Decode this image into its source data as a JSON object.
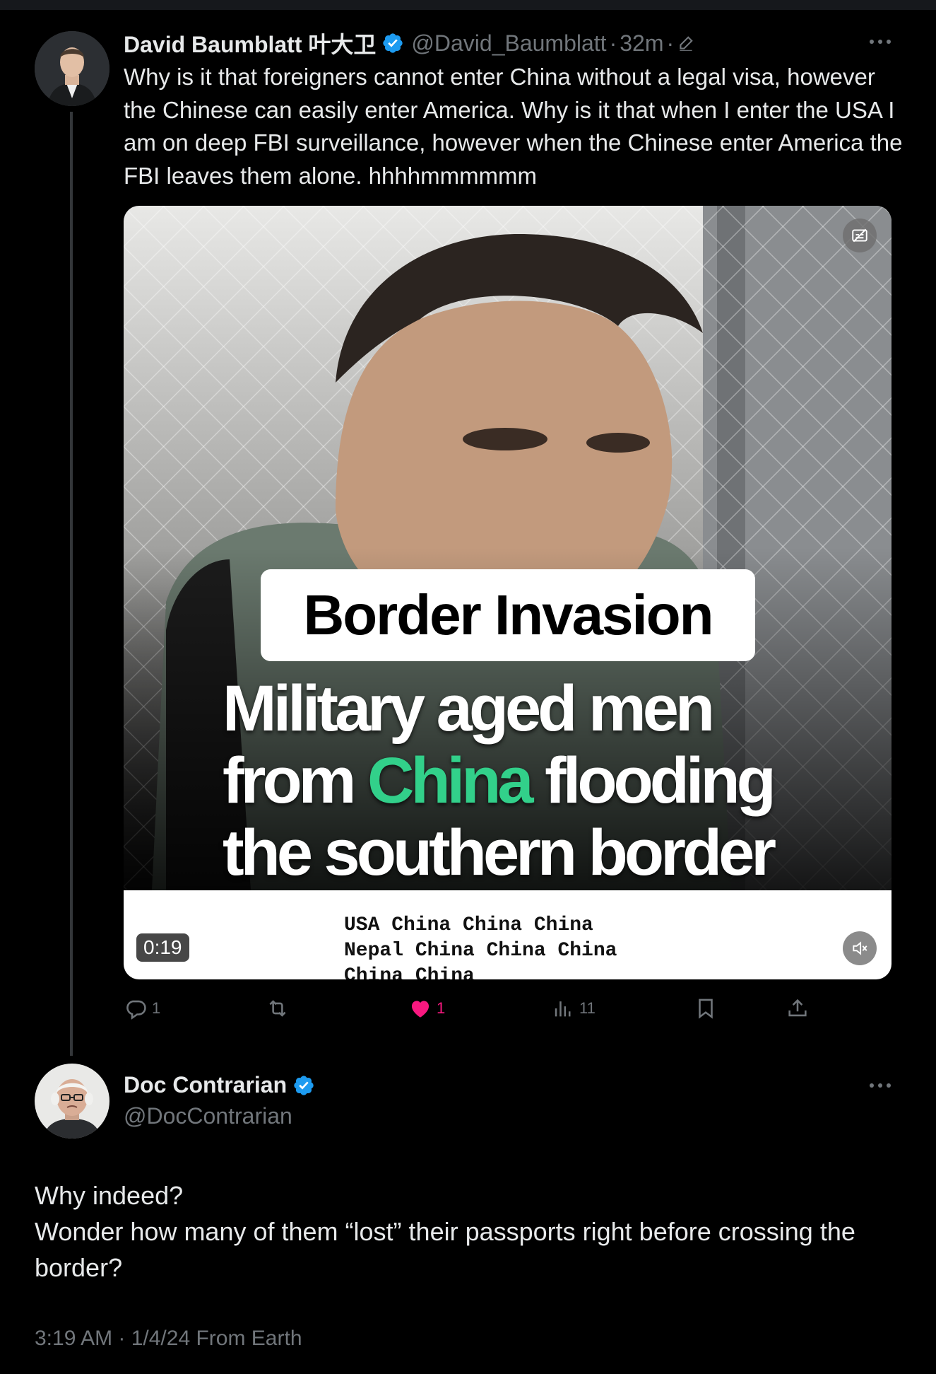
{
  "tweet": {
    "author_name": "David Baumblatt 叶大卫",
    "handle": "@David_Baumblatt",
    "separator": "·",
    "time_ago": "32m",
    "text": "Why is it that foreigners cannot enter China without a legal visa, however the Chinese can easily enter America.  Why is it that when I enter the USA I am on deep FBI surveillance, however when the Chinese enter America the FBI leaves them alone.  hhhhmmmmmm",
    "video": {
      "caption_box": "Border Invasion",
      "headline_1": "Military aged men",
      "headline_2a": "from ",
      "headline_2b": "China",
      "headline_2c": " flooding",
      "headline_3": "the southern border",
      "list_line_1": "USA China China China",
      "list_line_2": "Nepal China China China",
      "list_line_3": "China China",
      "duration": "0:19"
    },
    "actions": {
      "replies": "1",
      "likes": "1",
      "views": "11"
    }
  },
  "reply": {
    "author_name": "Doc Contrarian",
    "handle": "@DocContrarian",
    "text_line_1": "Why indeed?",
    "text_line_2": "Wonder how many of them “lost” their passports right before crossing the border?",
    "timestamp": "3:19 AM · 1/4/24 From Earth"
  },
  "colors": {
    "background": "#000000",
    "text": "#e7e9ea",
    "muted": "#71767b",
    "verified": "#1d9bf0",
    "like": "#f91880",
    "china_highlight": "#32d08a"
  },
  "icons": [
    "verified-badge-icon",
    "edit-pencil-icon",
    "more-icon",
    "reply-icon",
    "retweet-icon",
    "like-icon",
    "views-icon",
    "bookmark-icon",
    "share-icon",
    "mute-icon",
    "captions-off-icon"
  ]
}
